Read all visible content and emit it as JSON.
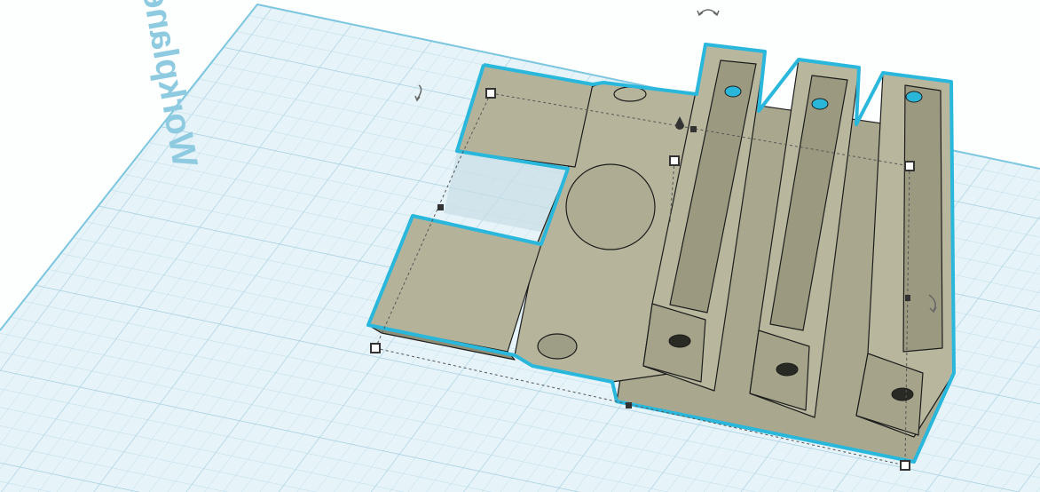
{
  "workplane": {
    "label": "Workplane"
  },
  "colors": {
    "grid_fill": "#e4f2f8",
    "grid_line": "#bcdbe8",
    "edge": "#2ab7dc",
    "part": "#b4b39a",
    "part_dark": "#8e8d76",
    "part_light": "#c4c3aa"
  },
  "icons": [
    "rotate-arrow-icon",
    "rotate-arrow-icon",
    "rotate-arrow-icon"
  ]
}
